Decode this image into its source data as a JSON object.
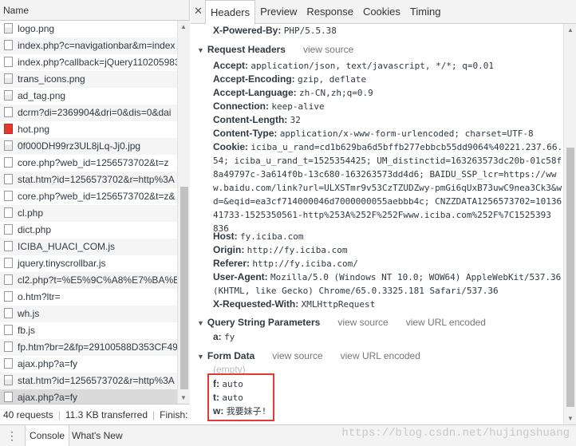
{
  "left": {
    "header": "Name",
    "requests": [
      {
        "name": "logo.png",
        "icon": "image-file-icon"
      },
      {
        "name": "index.php?c=navigationbar&m=index",
        "icon": "file-icon"
      },
      {
        "name": "index.php?callback=jQuery1102059835",
        "icon": "file-icon"
      },
      {
        "name": "trans_icons.png",
        "icon": "image-file-icon"
      },
      {
        "name": "ad_tag.png",
        "icon": "image-file-icon"
      },
      {
        "name": "dcrm?di=2369904&dri=0&dis=0&dai",
        "icon": "file-icon"
      },
      {
        "name": "hot.png",
        "icon": "red-image-icon"
      },
      {
        "name": "0f000DH99rz3UL8jLq-Jj0.jpg",
        "icon": "image-file-icon"
      },
      {
        "name": "core.php?web_id=1256573702&t=z",
        "icon": "file-icon"
      },
      {
        "name": "stat.htm?id=1256573702&r=http%3A",
        "icon": "file-icon"
      },
      {
        "name": "core.php?web_id=1256573702&t=z&",
        "icon": "file-icon"
      },
      {
        "name": "cl.php",
        "icon": "file-icon"
      },
      {
        "name": "dict.php",
        "icon": "file-icon"
      },
      {
        "name": "ICIBA_HUACI_COM.js",
        "icon": "file-icon"
      },
      {
        "name": "jquery.tinyscrollbar.js",
        "icon": "file-icon"
      },
      {
        "name": "cl2.php?t=%E5%9C%A8%E7%BA%BF.",
        "icon": "file-icon"
      },
      {
        "name": "o.htm?ltr=",
        "icon": "file-icon"
      },
      {
        "name": "wh.js",
        "icon": "file-icon"
      },
      {
        "name": "fb.js",
        "icon": "file-icon"
      },
      {
        "name": "fp.htm?br=2&fp=29100588D353CF49",
        "icon": "file-icon"
      },
      {
        "name": "ajax.php?a=fy",
        "icon": "file-icon"
      },
      {
        "name": "stat.htm?id=1256573702&r=http%3A",
        "icon": "image-file-icon"
      },
      {
        "name": "ajax.php?a=fy",
        "icon": "file-icon"
      }
    ],
    "selected_index": 22,
    "status": {
      "requests": "40 requests",
      "transferred": "11.3 KB transferred",
      "finish": "Finish:"
    }
  },
  "tabs": [
    "Headers",
    "Preview",
    "Response",
    "Cookies",
    "Timing"
  ],
  "active_tab": "Headers",
  "headers": {
    "x_powered_by": {
      "key": "X-Powered-By:",
      "value": "PHP/5.5.38"
    },
    "request_headers_title": "Request Headers",
    "view_source": "view source",
    "view_url_encoded": "view URL encoded",
    "request_headers": [
      {
        "key": "Accept:",
        "value": "application/json, text/javascript, */*; q=0.01"
      },
      {
        "key": "Accept-Encoding:",
        "value": "gzip, deflate"
      },
      {
        "key": "Accept-Language:",
        "value": "zh-CN,zh;q=0.9"
      },
      {
        "key": "Connection:",
        "value": "keep-alive"
      },
      {
        "key": "Content-Length:",
        "value": "32"
      },
      {
        "key": "Content-Type:",
        "value": "application/x-www-form-urlencoded; charset=UTF-8"
      }
    ],
    "cookie": {
      "key": "Cookie:",
      "lines": [
        "iciba_u_rand=cd1b629ba6d5bffb277ebbcb55dd9064%40221.237.66.",
        "54; iciba_u_rand_t=1525354425; UM_distinctid=163263573dc20b-01c58f",
        "8a49797c-3a614f0b-13c680-163263573dd4d6; BAIDU_SSP_lcr=https://ww",
        "w.baidu.com/link?url=ULXSTmr9v53CzTZUDZwy-pmGi6qUxB73uwC9nea3Ck3&w",
        "d=&eqid=ea3cf714000046d7000000055aebbb4c; CNZZDATA1256573702=10136",
        "41733-1525350561-http%253A%252F%252Fwww.iciba.com%252F%7C1525393",
        "836"
      ]
    },
    "host": {
      "key": "Host:",
      "value": "fy.iciba.com"
    },
    "origin": {
      "key": "Origin:",
      "value": "http://fy.iciba.com"
    },
    "referer": {
      "key": "Referer:",
      "value": "http://fy.iciba.com/"
    },
    "user_agent": {
      "key": "User-Agent:",
      "lines": [
        "Mozilla/5.0 (Windows NT 10.0; WOW64) AppleWebKit/537.36",
        "(KHTML, like Gecko) Chrome/65.0.3325.181 Safari/537.36"
      ]
    },
    "x_requested_with": {
      "key": "X-Requested-With:",
      "value": "XMLHttpRequest"
    },
    "query_title": "Query String Parameters",
    "query_params": [
      {
        "key": "a:",
        "value": "fy"
      }
    ],
    "form_title": "Form Data",
    "form_empty": "(empty)",
    "form_data": [
      {
        "key": "f:",
        "value": "auto"
      },
      {
        "key": "t:",
        "value": "auto"
      },
      {
        "key": "w:",
        "value": "我要妹子!"
      }
    ]
  },
  "drawer": {
    "tabs": [
      "Console",
      "What's New"
    ],
    "active": "Console"
  },
  "watermark": "https://blog.csdn.net/hujingshuang"
}
